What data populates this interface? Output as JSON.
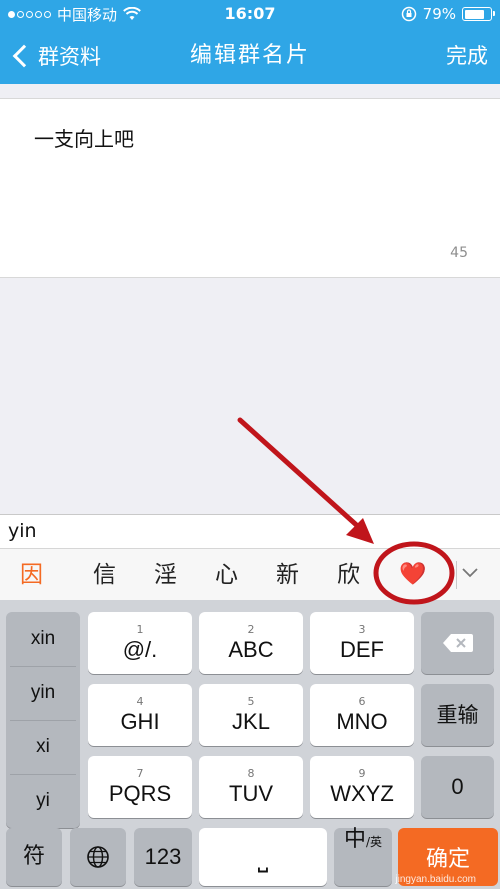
{
  "status_bar": {
    "carrier": "中国移动",
    "time": "16:07",
    "battery_percent": "79%",
    "battery_level": 0.79,
    "icons": [
      "signal-dots-icon",
      "wifi-icon",
      "rotation-lock-icon",
      "battery-icon"
    ]
  },
  "nav": {
    "back_label": "群资料",
    "title": "编辑群名片",
    "done_label": "完成"
  },
  "editor": {
    "value": "一支向上吧",
    "char_count": "45"
  },
  "ime": {
    "composing": "yin",
    "candidates": [
      "因",
      "信",
      "淫",
      "心",
      "新",
      "欣",
      "❤️"
    ],
    "pinyin_options": [
      "xin",
      "yin",
      "xi",
      "yi"
    ],
    "keys": [
      {
        "num": "1",
        "label": "@/."
      },
      {
        "num": "2",
        "label": "ABC"
      },
      {
        "num": "3",
        "label": "DEF"
      },
      {
        "num": "4",
        "label": "GHI"
      },
      {
        "num": "5",
        "label": "JKL"
      },
      {
        "num": "6",
        "label": "MNO"
      },
      {
        "num": "7",
        "label": "PQRS"
      },
      {
        "num": "8",
        "label": "TUV"
      },
      {
        "num": "9",
        "label": "WXYZ"
      }
    ],
    "reenter_label": "重输",
    "zero_label": "0",
    "symbol_label": "符",
    "numeric_label": "123",
    "space_label": "⎵",
    "lang_label": "中",
    "lang_sub_label": "/英",
    "confirm_label": "确定",
    "accent_color": "#f46a23"
  },
  "watermark": "jingyan.baidu.com",
  "colors": {
    "nav_bg": "#2fa6e6",
    "annotation_red": "#c0151b"
  }
}
